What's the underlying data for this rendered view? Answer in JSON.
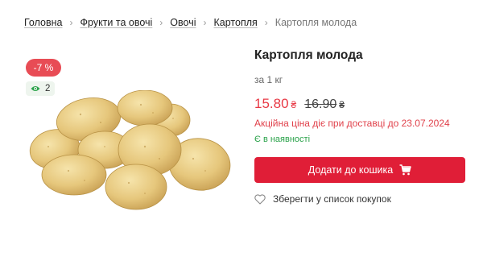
{
  "breadcrumb": {
    "items": [
      "Головна",
      "Фрукти та овочі",
      "Овочі",
      "Картопля"
    ],
    "current": "Картопля молода"
  },
  "product": {
    "discount_badge": "-7 %",
    "views_count": "2",
    "title": "Картопля молода",
    "unit": "за 1 кг",
    "price_new": "15.80",
    "price_old": "16.90",
    "currency": "₴",
    "promo_text": "Акційна ціна діє при доставці до 23.07.2024",
    "stock_status": "Є в наявності",
    "add_to_cart_label": "Додати до кошика",
    "wishlist_label": "Зберегти у список покупок"
  },
  "colors": {
    "accent": "#e01e37",
    "discount_badge_bg": "#e84c55",
    "price_new": "#e83844",
    "in_stock": "#2aa24a"
  },
  "icons": {
    "breadcrumb_separator": "chevron-right-icon",
    "views": "eye-icon",
    "cart": "cart-icon",
    "wishlist": "heart-icon"
  }
}
